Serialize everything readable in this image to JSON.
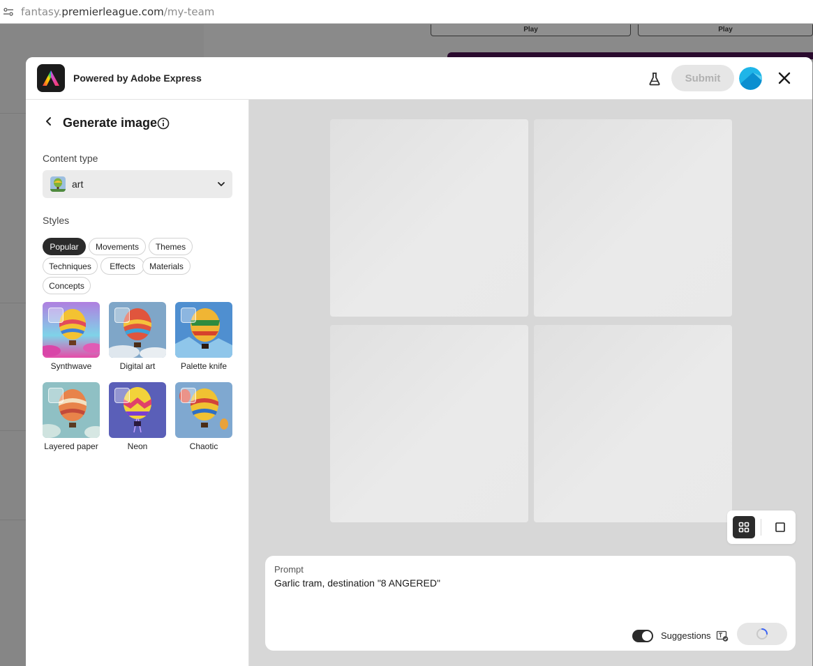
{
  "browser": {
    "url_prefix": "fantasy.",
    "url_host": "premierleague.com",
    "url_path": "/my-team"
  },
  "background_page": {
    "play_buttons": [
      "Play",
      "Play"
    ]
  },
  "modal": {
    "header": {
      "title": "Powered by Adobe Express",
      "submit_label": "Submit"
    },
    "panel": {
      "title": "Generate image",
      "content_type_label": "Content type",
      "content_type_value": "art",
      "styles_label": "Styles",
      "chips": [
        "Popular",
        "Movements",
        "Themes",
        "Techniques",
        "Effects",
        "Materials",
        "Concepts"
      ],
      "active_chip": "Popular",
      "styles": [
        {
          "name": "Synthwave"
        },
        {
          "name": "Digital art"
        },
        {
          "name": "Palette knife"
        },
        {
          "name": "Layered paper"
        },
        {
          "name": "Neon"
        },
        {
          "name": "Chaotic"
        }
      ]
    },
    "prompt": {
      "label": "Prompt",
      "text": "Garlic tram, destination \"8 ANGERED\"",
      "suggestions_label": "Suggestions",
      "suggestions_enabled": true
    },
    "view_mode": "grid"
  }
}
